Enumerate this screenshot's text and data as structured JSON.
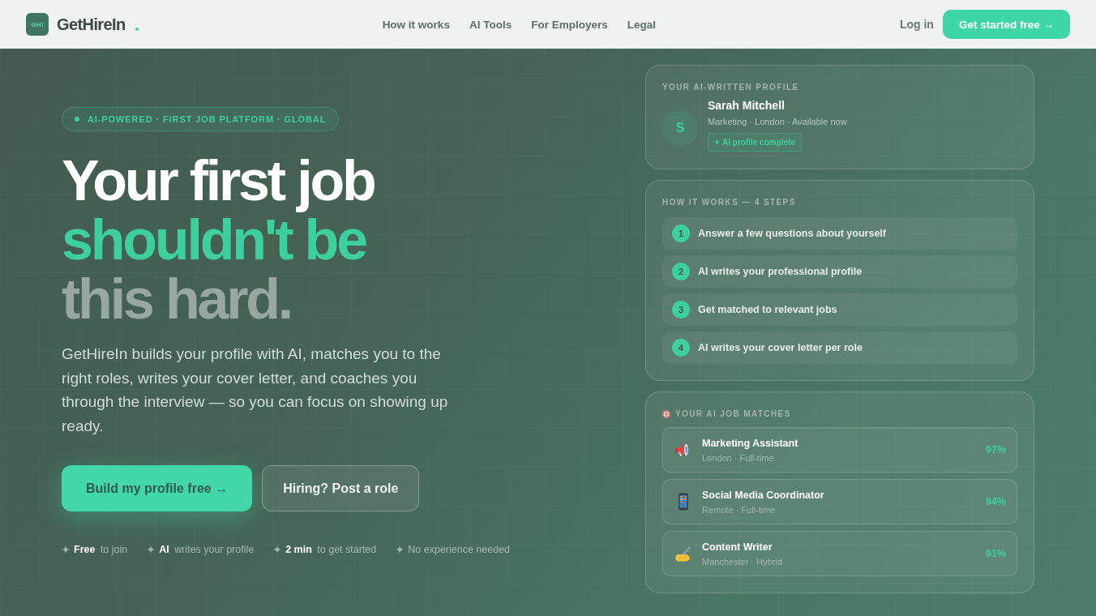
{
  "nav": {
    "logo_mark": "GHI",
    "brand": "GetHireIn",
    "links": [
      "How it works",
      "AI Tools",
      "For Employers",
      "Legal"
    ],
    "login": "Log in",
    "cta": "Get started free →"
  },
  "hero": {
    "tagline": "AI-POWERED · FIRST JOB PLATFORM · GLOBAL",
    "headline": [
      {
        "text": "Your first job",
        "kind": "plain"
      },
      {
        "text": "shouldn't be",
        "kind": "accent"
      },
      {
        "text": "this hard.",
        "kind": "muted"
      }
    ],
    "description": "GetHireIn builds your profile with AI, matches you to the right roles, writes your cover letter, and coaches you through the interview — so you can focus on showing up ready.",
    "buttons": [
      {
        "label": "Build my profile free →",
        "kind": "primary"
      },
      {
        "label": "Hiring? Post a role",
        "kind": "secondary"
      }
    ],
    "features": [
      "**Free** to join",
      "**AI** writes your profile",
      "**2 min** to get started",
      "No experience needed"
    ]
  },
  "profile_card": {
    "heading": "YOUR AI-WRITTEN PROFILE",
    "avatar_initial": "S",
    "name": "Sarah Mitchell",
    "details": "Marketing · London · Available now",
    "badge": "AI profile complete"
  },
  "steps_card": {
    "heading": "HOW IT WORKS — 4 STEPS",
    "steps": [
      {
        "number": "1",
        "text": "Answer a few questions about yourself"
      },
      {
        "number": "2",
        "text": "AI writes your professional profile"
      },
      {
        "number": "3",
        "text": "Get matched to relevant jobs"
      },
      {
        "number": "4",
        "text": "AI writes your cover letter per role"
      }
    ]
  },
  "matches_card": {
    "heading": "YOUR AI JOB MATCHES",
    "jobs": [
      {
        "title": "Marketing Assistant",
        "details": "London · Full-time",
        "match": "97%"
      },
      {
        "title": "Social Media Coordinator",
        "details": "Remote · Full-time",
        "match": "94%"
      },
      {
        "title": "Content Writer",
        "details": "Manchester · Hybrid",
        "match": "91%"
      }
    ]
  }
}
